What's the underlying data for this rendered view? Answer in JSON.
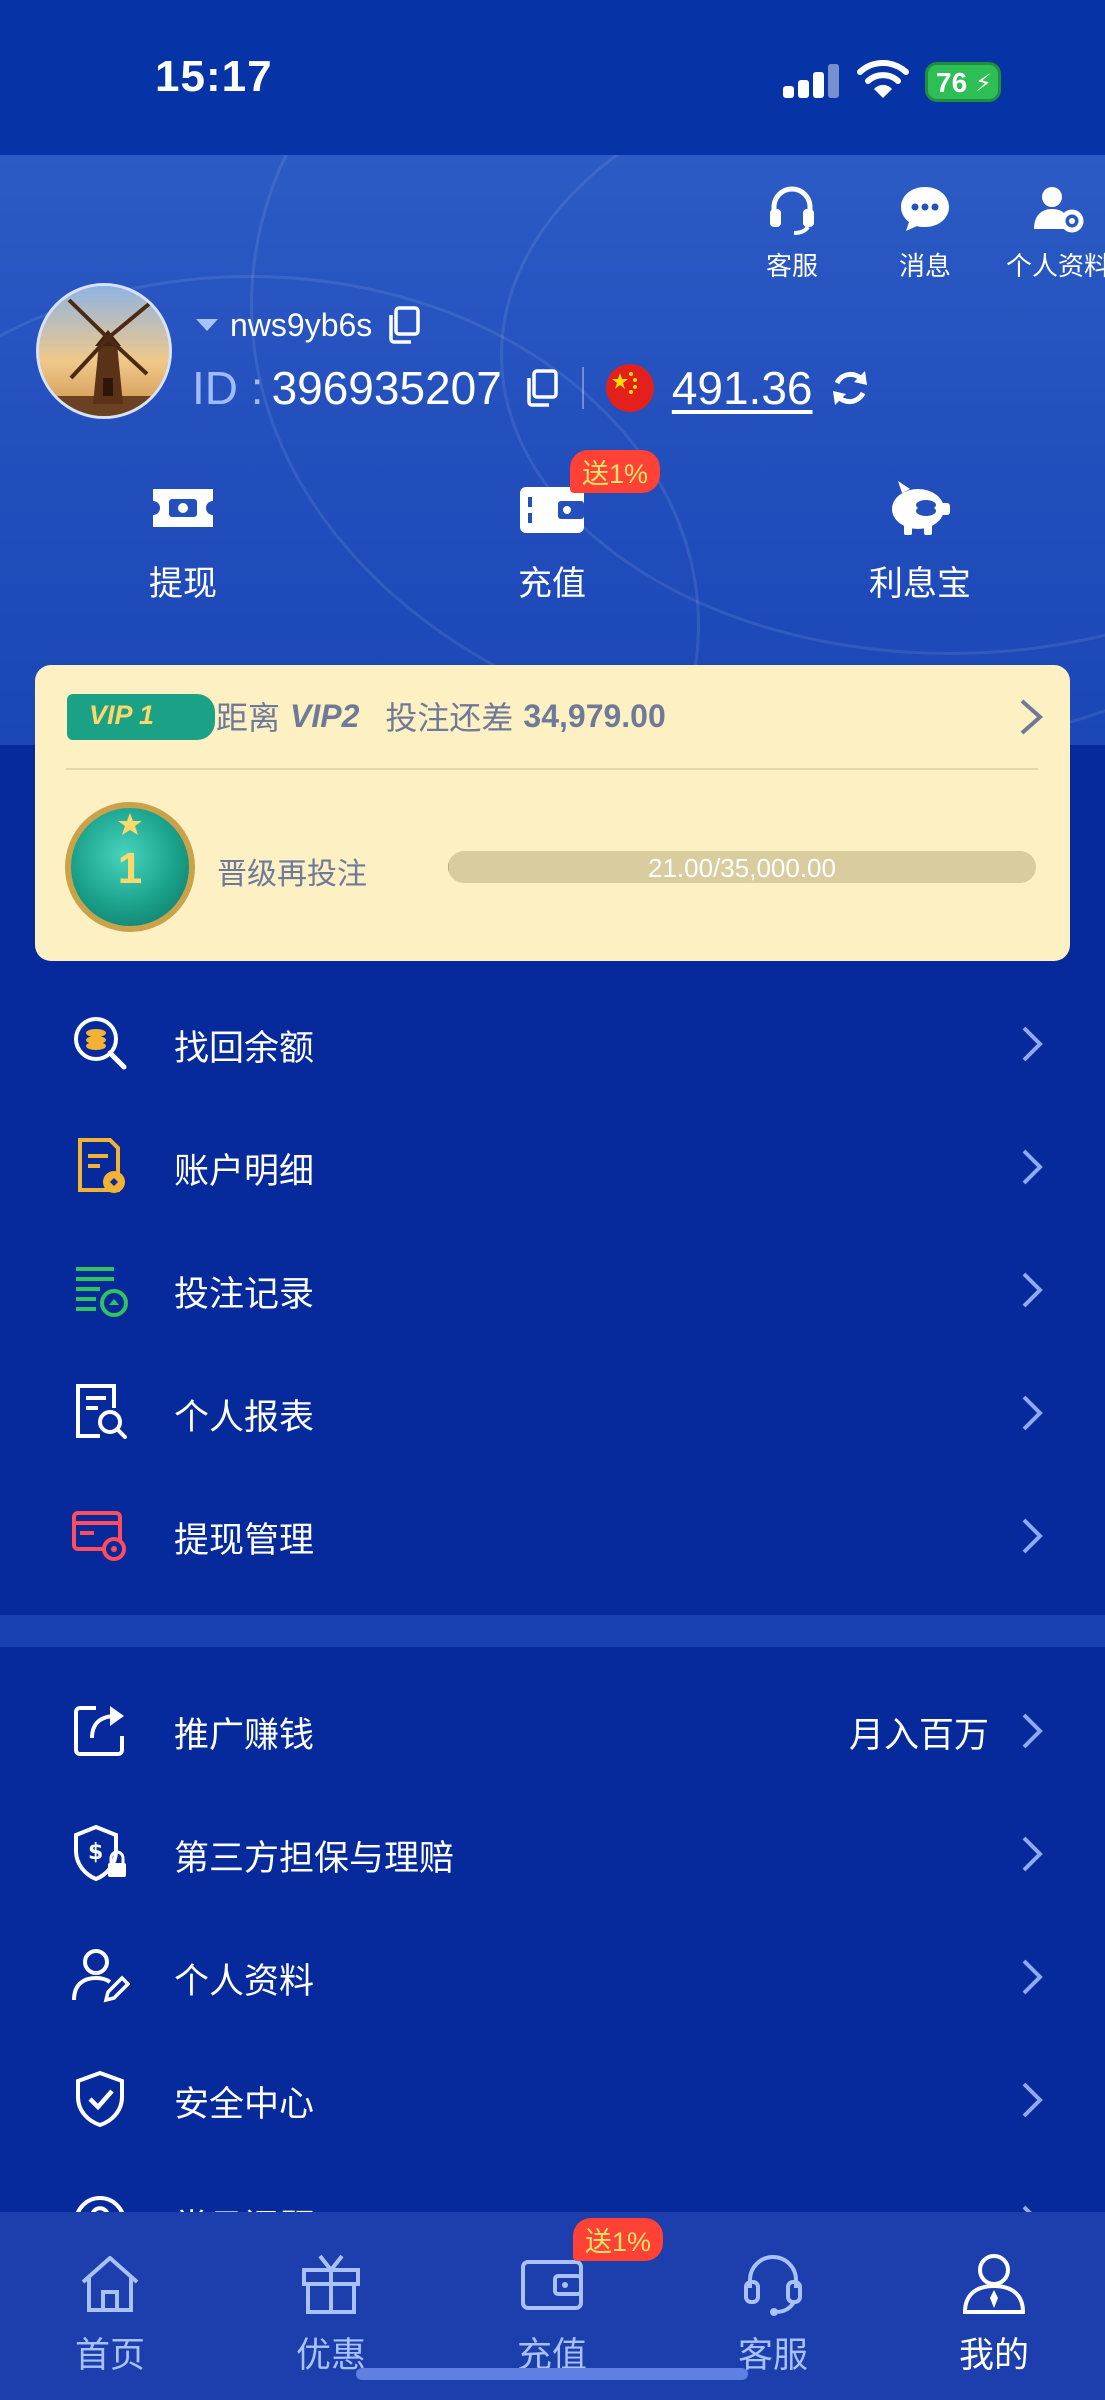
{
  "status": {
    "time": "15:17",
    "battery": "76"
  },
  "header": {
    "actions": [
      {
        "label": "客服",
        "icon": "headset-icon"
      },
      {
        "label": "消息",
        "icon": "chat-bubble-icon"
      },
      {
        "label": "个人资料",
        "icon": "user-settings-icon"
      }
    ],
    "username": "nws9yb6s",
    "id_label": "ID :",
    "id_value": "396935207",
    "balance": "491.36",
    "quick_actions": [
      {
        "label": "提现",
        "icon": "withdraw-ticket-icon"
      },
      {
        "label": "充值",
        "icon": "wallet-icon",
        "badge": "送1%"
      },
      {
        "label": "利息宝",
        "icon": "piggy-bank-icon"
      }
    ]
  },
  "vip": {
    "tag": "VIP 1",
    "distance_prefix": "距离",
    "next_level": "VIP2",
    "bet_diff_label": "投注还差",
    "bet_diff_value": "34,979.00",
    "level_number": "1",
    "progress_label": "晋级再投注",
    "progress_text": "21.00/35,000.00",
    "progress_fraction": 0.0006
  },
  "menu_group_1": [
    {
      "label": "找回余额",
      "icon": "search-coins-icon"
    },
    {
      "label": "账户明细",
      "icon": "account-details-icon"
    },
    {
      "label": "投注记录",
      "icon": "bet-records-icon"
    },
    {
      "label": "个人报表",
      "icon": "report-search-icon"
    },
    {
      "label": "提现管理",
      "icon": "withdraw-settings-icon"
    }
  ],
  "menu_group_2": [
    {
      "label": "推广赚钱",
      "icon": "share-icon",
      "extra": "月入百万"
    },
    {
      "label": "第三方担保与理赔",
      "icon": "shield-dollar-icon"
    },
    {
      "label": "个人资料",
      "icon": "user-edit-icon"
    },
    {
      "label": "安全中心",
      "icon": "shield-check-icon"
    },
    {
      "label": "常见问题",
      "icon": "question-icon"
    }
  ],
  "tabbar": {
    "items": [
      {
        "label": "首页",
        "icon": "home-icon"
      },
      {
        "label": "优惠",
        "icon": "gift-icon"
      },
      {
        "label": "充值",
        "icon": "wallet-icon",
        "badge": "送1%"
      },
      {
        "label": "客服",
        "icon": "headset-icon"
      },
      {
        "label": "我的",
        "icon": "user-icon",
        "active": true
      }
    ]
  },
  "colors": {
    "background": "#062a9b",
    "header": "#2450be",
    "vip_card": "#fdf0c2",
    "badge": "#ff4136",
    "accent_green": "#1aa186"
  }
}
